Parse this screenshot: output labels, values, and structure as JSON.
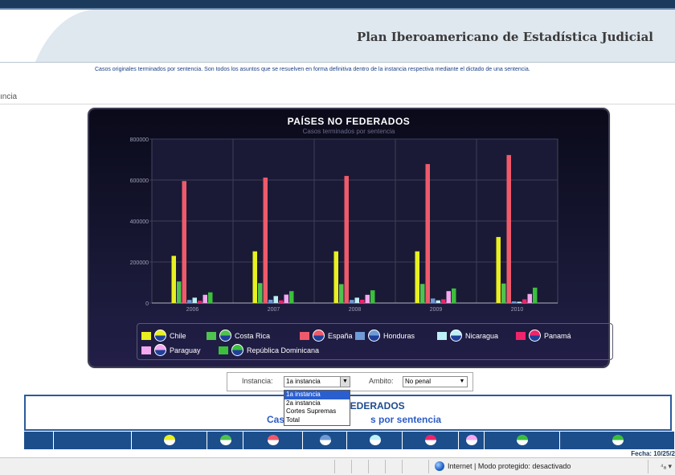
{
  "site": {
    "title": "Plan Iberoamericano de Estadística Judicial",
    "description": "Casos originales terminados por sentencia. Son todos los asuntos que se resuelven en forma definitiva dentro de la instancia respectiva mediante el dictado de una sentencia.",
    "breadcrumb_fragment": "ıncia"
  },
  "chart_data": {
    "type": "bar",
    "title": "PAÍSES NO FEDERADOS",
    "subtitle": "Casos terminados por sentencia",
    "categories": [
      "2006",
      "2007",
      "2008",
      "2009",
      "2010"
    ],
    "ylim": [
      0,
      800000
    ],
    "yticks": [
      "0",
      "200000",
      "400000",
      "600000",
      "800000"
    ],
    "grid": true,
    "legend_position": "bottom",
    "series": [
      {
        "name": "Chile",
        "color": "#e8f020",
        "values": [
          230000,
          252000,
          252000,
          252000,
          322000
        ]
      },
      {
        "name": "Costa Rica",
        "color": "#4fc24f",
        "values": [
          105000,
          97000,
          92000,
          93000,
          95000
        ]
      },
      {
        "name": "España",
        "color": "#ef5a6a",
        "values": [
          595000,
          612000,
          620000,
          678000,
          722000
        ]
      },
      {
        "name": "Honduras",
        "color": "#6f9ad6",
        "values": [
          15000,
          16000,
          15000,
          22000,
          8000
        ]
      },
      {
        "name": "Nicaragua",
        "color": "#bdf0f6",
        "values": [
          26000,
          34000,
          26000,
          13000,
          6000
        ]
      },
      {
        "name": "Panamá",
        "color": "#f0246a",
        "values": [
          11000,
          13000,
          16000,
          18000,
          18000
        ]
      },
      {
        "name": "Paraguay",
        "color": "#f4a8f0",
        "values": [
          40000,
          41000,
          40000,
          58000,
          44000
        ]
      },
      {
        "name": "República Dominicana",
        "color": "#3cbf3c",
        "values": [
          52000,
          58000,
          62000,
          71000,
          75000
        ]
      }
    ]
  },
  "filters": {
    "instancia_label": "Instancia:",
    "instancia_value": "1a instancia",
    "ambito_label": "Ambito:",
    "ambito_value": "No penal",
    "instancia_options": [
      "1a instancia",
      "2a instancia",
      "Cortes Supremas",
      "Total"
    ]
  },
  "table": {
    "title_visible": "FEDERADOS",
    "subtitle_left": "Cas",
    "subtitle_right": "s por sentencia"
  },
  "footer": {
    "fecha": "Fecha: 10/25/2"
  },
  "statusbar": {
    "zone_text": "Internet | Modo protegido: desactivado",
    "zoom_text": "⁴ₐ ▾"
  }
}
